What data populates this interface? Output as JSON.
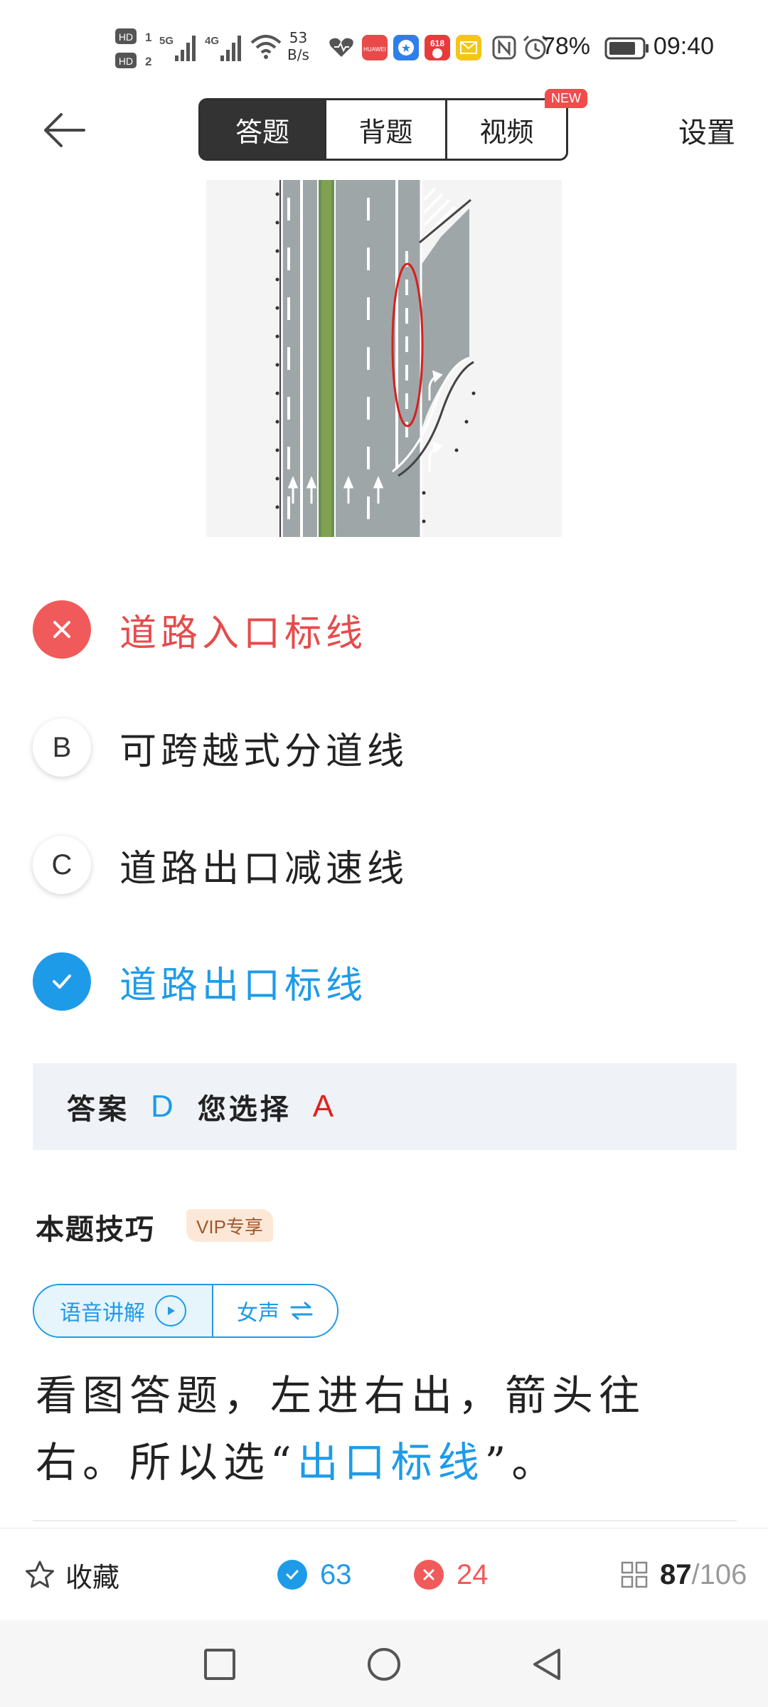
{
  "status_bar": {
    "net_speed_value": "53",
    "net_speed_unit": "B/s",
    "battery_percent": "78%",
    "time": "09:40",
    "icons": [
      "hd-icon",
      "5g-signal-icon",
      "4g-signal-icon",
      "wifi-icon",
      "health-icon",
      "app-notification-icon",
      "app-notification-icon",
      "app-618-icon",
      "mail-icon",
      "nfc-icon",
      "alarm-icon",
      "battery-icon"
    ]
  },
  "header": {
    "tabs": [
      {
        "label": "答题",
        "active": true
      },
      {
        "label": "背题",
        "active": false
      },
      {
        "label": "视频",
        "active": false
      }
    ],
    "new_badge": "NEW",
    "settings_label": "设置"
  },
  "options": [
    {
      "key": "A",
      "text": "道路入口标线",
      "state": "wrong"
    },
    {
      "key": "B",
      "text": "可跨越式分道线",
      "state": "plain"
    },
    {
      "key": "C",
      "text": "道路出口减速线",
      "state": "plain"
    },
    {
      "key": "D",
      "text": "道路出口标线",
      "state": "right"
    }
  ],
  "answer": {
    "label": "答案",
    "correct": "D",
    "chosen_label": "您选择",
    "chosen": "A"
  },
  "tips": {
    "title": "本题技巧",
    "vip_badge": "VIP专享",
    "voice_label": "语音讲解",
    "voice_gender": "女声",
    "explain_part1": "看图答题，左进右出，箭头往右。所以选“",
    "explain_highlight": "出口标线",
    "explain_part2": "”。"
  },
  "bottom_bar": {
    "favorite_label": "收藏",
    "correct_count": "63",
    "wrong_count": "24",
    "current_index": "87",
    "total": "/106"
  },
  "colors": {
    "accent": "#1e9be8",
    "wrong": "#f15a5a",
    "active_tab": "#333333",
    "answer_box": "#eff3f8"
  }
}
